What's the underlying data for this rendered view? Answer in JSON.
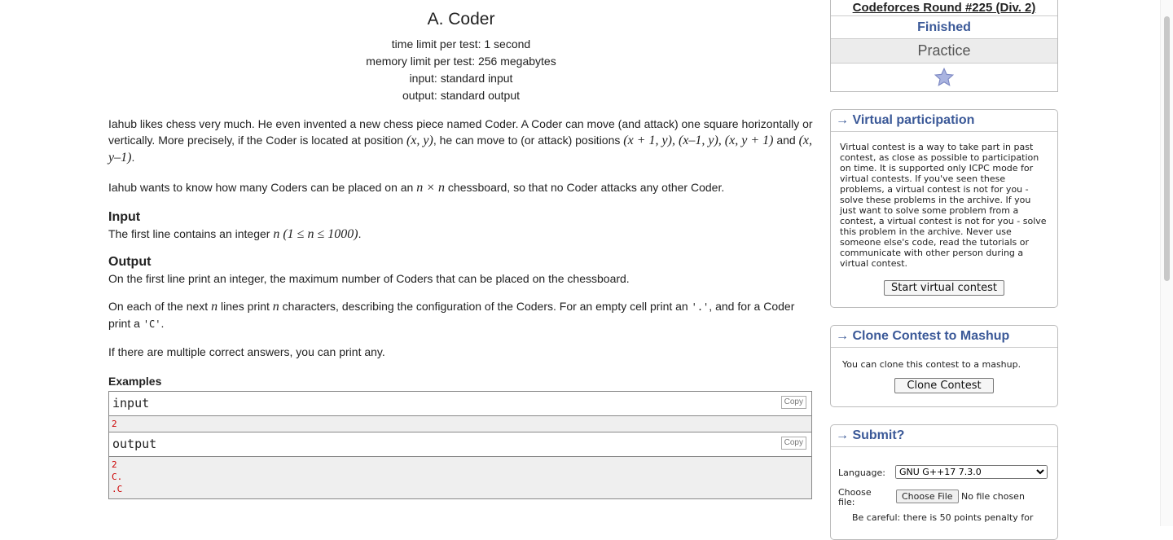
{
  "problem": {
    "title": "A. Coder",
    "limits": [
      "time limit per test: 1 second",
      "memory limit per test: 256 megabytes",
      "input: standard input",
      "output: standard output"
    ],
    "statement1_a": "Iahub likes chess very much. He even invented a new chess piece named Coder. A Coder can move (and attack) one square horizontally or vertically. More precisely, if the Coder is located at position ",
    "pos": "(x, y)",
    "statement1_b": ", he can move to (or attack) positions ",
    "moves": "(x + 1, y), (x–1, y), (x, y + 1)",
    "statement1_c": " and ",
    "last_move": "(x, y–1)",
    "statement1_d": ".",
    "statement2_a": "Iahub wants to know how many Coders can be placed on an ",
    "board": "n × n",
    "statement2_b": " chessboard, so that no Coder attacks any other Coder.",
    "input_title": "Input",
    "input_a": "The first line contains an integer ",
    "input_math": "n (1 ≤ n ≤ 1000)",
    "input_b": ".",
    "output_title": "Output",
    "output_p1": "On the first line print an integer, the maximum number of Coders that can be placed on the chessboard.",
    "output_p2_a": "On each of the next ",
    "n": "n",
    "output_p2_b": " lines print ",
    "output_p2_c": " characters, describing the configuration of the Coders. For an empty cell print an ",
    "dot": "'.'",
    "output_p2_d": ", and for a Coder print a ",
    "cchar": "'C'",
    "output_p2_e": ".",
    "note": "If there are multiple correct answers, you can print any.",
    "examples_title": "Examples",
    "input_label": "input",
    "output_label": "output",
    "copy_label": "Copy",
    "sample_input": "2",
    "sample_output": [
      "2",
      "C.",
      ".C"
    ]
  },
  "sidebar": {
    "contest_name": "Codeforces Round #225 (Div. 2)",
    "status": "Finished",
    "practice": "Practice",
    "virtual": {
      "title": "→ Virtual participation",
      "text": "Virtual contest is a way to take part in past contest, as close as possible to participation on time. It is supported only ICPC mode for virtual contests. If you've seen these problems, a virtual contest is not for you - solve these problems in the archive. If you just want to solve some problem from a contest, a virtual contest is not for you - solve this problem in the archive. Never use someone else's code, read the tutorials or communicate with other person during a virtual contest.",
      "button": "Start virtual contest"
    },
    "clone": {
      "title": "→ Clone Contest to Mashup",
      "text": "You can clone this contest to a mashup.",
      "button": "Clone Contest"
    },
    "submit": {
      "title": "→ Submit?",
      "language_label": "Language:",
      "language_value": "GNU G++17 7.3.0",
      "file_label": "Choose file:",
      "file_button": "Choose File",
      "file_status": "No file chosen",
      "warning": "Be careful: there is 50 points penalty for"
    }
  }
}
